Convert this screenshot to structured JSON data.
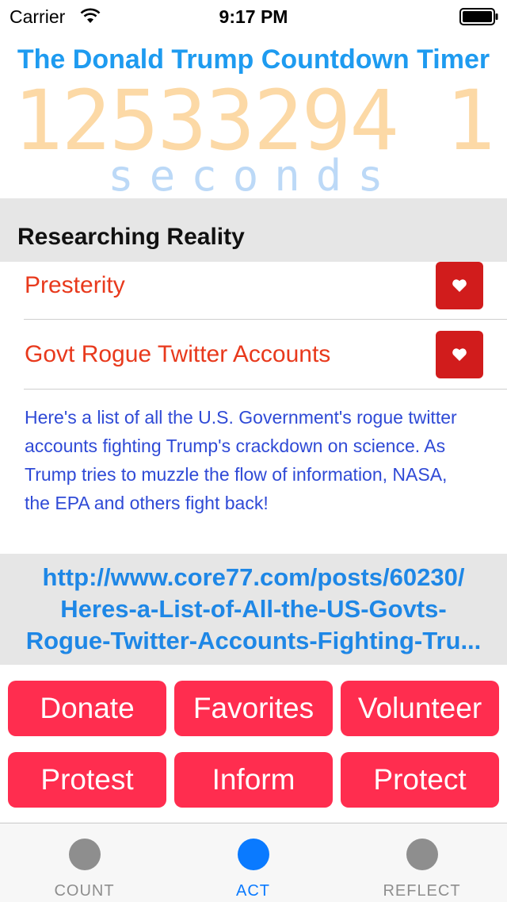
{
  "status_bar": {
    "carrier": "Carrier",
    "time": "9:17 PM"
  },
  "header": {
    "title": "The Donald Trump Countdown Timer",
    "countdown": "12533294 1",
    "unit": "seconds"
  },
  "section": {
    "title": "Researching Reality"
  },
  "list": {
    "items": [
      {
        "label": "Presterity"
      },
      {
        "label": "Govt Rogue Twitter Accounts"
      }
    ]
  },
  "detail": {
    "description": "Here's a list of all the U.S. Government's rogue twitter accounts fighting Trump's crackdown on science. As Trump tries to muzzle the flow of information, NASA, the EPA and others fight back!",
    "url_lines": [
      "http://www.core77.com/posts/60230/",
      "Heres-a-List-of-All-the-US-Govts-",
      "Rogue-Twitter-Accounts-Fighting-Tru..."
    ]
  },
  "actions": {
    "donate": "Donate",
    "favorites": "Favorites",
    "volunteer": "Volunteer",
    "protest": "Protest",
    "inform": "Inform",
    "protect": "Protect"
  },
  "tabs": [
    {
      "label": "COUNT",
      "active": false
    },
    {
      "label": "ACT",
      "active": true
    },
    {
      "label": "REFLECT",
      "active": false
    }
  ],
  "colors": {
    "title": "#1e9bf0",
    "countdown": "#fcd9a6",
    "link_red": "#e8391c",
    "button_red": "#ff2d4f",
    "favorite_red": "#d11c1c",
    "tab_active": "#0a7aff",
    "tab_inactive": "#8e8e8e"
  }
}
